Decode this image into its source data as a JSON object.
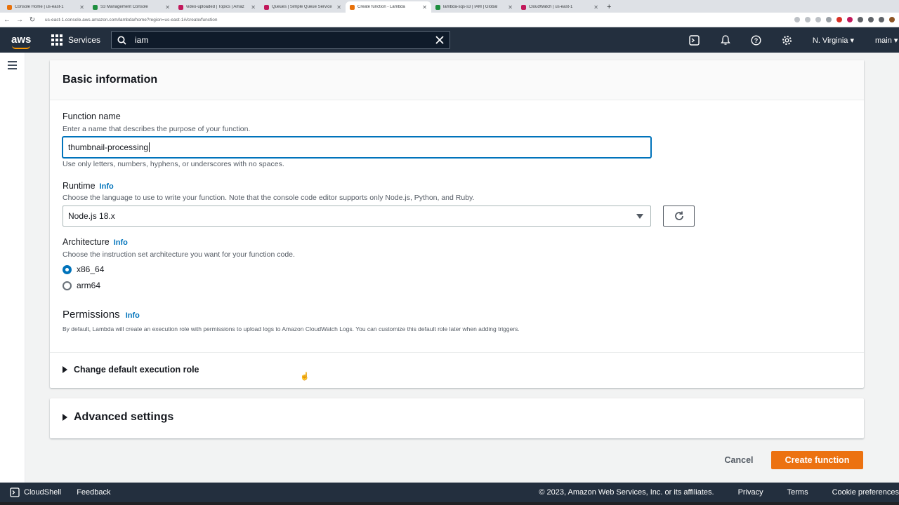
{
  "browser": {
    "tabs": [
      {
        "label": "Console Home | us-east-1",
        "color": "#e8710a",
        "active": false
      },
      {
        "label": "S3 Management Console",
        "color": "#1e8e3e",
        "active": false
      },
      {
        "label": "video-uploaded | Topics | Amaz",
        "color": "#c2185b",
        "active": false
      },
      {
        "label": "Queues | Simple Queue Service",
        "color": "#c2185b",
        "active": false
      },
      {
        "label": "Create function - Lambda",
        "color": "#e8710a",
        "active": true
      },
      {
        "label": "lambda-sqs-s3 | IAM | Global",
        "color": "#c2185b",
        "active": false
      },
      {
        "label": "CloudWatch | us-east-1",
        "color": "#c2185b",
        "active": false
      }
    ],
    "url": "us-east-1.console.aws.amazon.com/lambda/home?region=us-east-1#/create/function"
  },
  "nav": {
    "logo": "aws",
    "services_label": "Services",
    "search_value": "iam",
    "region": "N. Virginia",
    "account": "main"
  },
  "form": {
    "section_title": "Basic information",
    "function_name": {
      "label": "Function name",
      "description": "Enter a name that describes the purpose of your function.",
      "value": "thumbnail-processing",
      "constraint": "Use only letters, numbers, hyphens, or underscores with no spaces."
    },
    "runtime": {
      "label": "Runtime",
      "info": "Info",
      "description": "Choose the language to use to write your function. Note that the console code editor supports only Node.js, Python, and Ruby.",
      "selected": "Node.js 18.x"
    },
    "architecture": {
      "label": "Architecture",
      "info": "Info",
      "description": "Choose the instruction set architecture you want for your function code.",
      "options": [
        "x86_64",
        "arm64"
      ],
      "selected": "x86_64"
    },
    "permissions": {
      "title": "Permissions",
      "info": "Info",
      "description": "By default, Lambda will create an execution role with permissions to upload logs to Amazon CloudWatch Logs. You can customize this default role later when adding triggers."
    },
    "change_role_label": "Change default execution role",
    "advanced_settings_label": "Advanced settings"
  },
  "actions": {
    "cancel": "Cancel",
    "create": "Create function"
  },
  "footer": {
    "cloudshell": "CloudShell",
    "feedback": "Feedback",
    "copyright": "© 2023, Amazon Web Services, Inc. or its affiliates.",
    "privacy": "Privacy",
    "terms": "Terms",
    "cookies": "Cookie preferences"
  }
}
